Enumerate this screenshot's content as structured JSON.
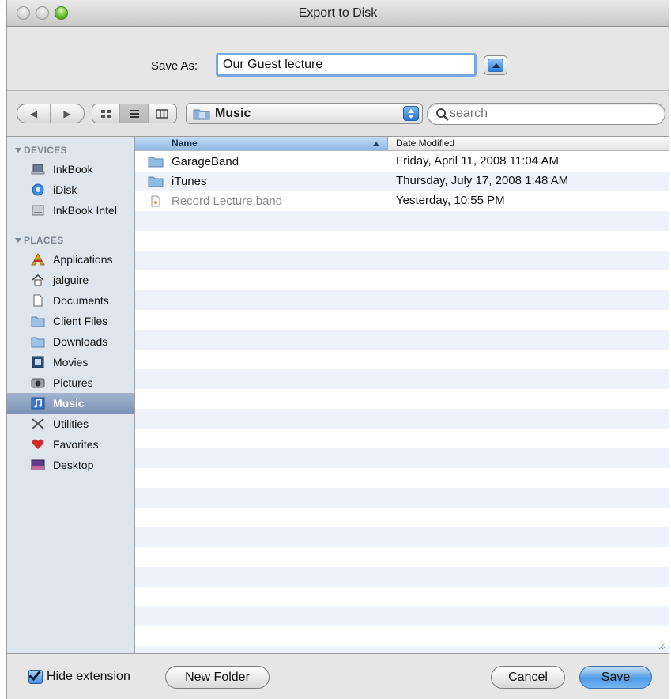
{
  "window": {
    "title": "Export to Disk"
  },
  "save_as": {
    "label": "Save As:",
    "value": "Our Guest lecture"
  },
  "toolbar": {
    "nav": [
      "◀",
      "▶"
    ],
    "views": [
      "icon-view",
      "list-view",
      "column-view"
    ],
    "location": "Music",
    "search_placeholder": "search"
  },
  "sidebar": {
    "devices_header": "DEVICES",
    "devices": [
      {
        "label": "InkBook",
        "icon": "laptop-icon"
      },
      {
        "label": "iDisk",
        "icon": "idisk-icon"
      },
      {
        "label": "InkBook Intel",
        "icon": "harddisk-icon"
      }
    ],
    "places_header": "PLACES",
    "places": [
      {
        "label": "Applications",
        "icon": "applications-icon"
      },
      {
        "label": "jalguire",
        "icon": "home-icon"
      },
      {
        "label": "Documents",
        "icon": "documents-icon"
      },
      {
        "label": "Client Files",
        "icon": "folder-icon"
      },
      {
        "label": "Downloads",
        "icon": "folder-icon"
      },
      {
        "label": "Movies",
        "icon": "movies-icon"
      },
      {
        "label": "Pictures",
        "icon": "pictures-icon"
      },
      {
        "label": "Music",
        "icon": "music-icon",
        "selected": true
      },
      {
        "label": "Utilities",
        "icon": "utilities-icon"
      },
      {
        "label": "Favorites",
        "icon": "heart-icon"
      },
      {
        "label": "Desktop",
        "icon": "desktop-icon"
      }
    ]
  },
  "files": {
    "columns": {
      "name": "Name",
      "date": "Date Modified"
    },
    "rows": [
      {
        "name": "GarageBand",
        "date": "Friday, April 11, 2008 11:04 AM",
        "type": "folder"
      },
      {
        "name": "iTunes",
        "date": "Thursday, July 17, 2008 1:48 AM",
        "type": "folder"
      },
      {
        "name": "Record Lecture.band",
        "date": "Yesterday, 10:55 PM",
        "type": "document"
      }
    ]
  },
  "bottom": {
    "hide_extension_label": "Hide extension",
    "hide_extension_checked": true,
    "new_folder": "New Folder",
    "cancel": "Cancel",
    "save": "Save"
  }
}
